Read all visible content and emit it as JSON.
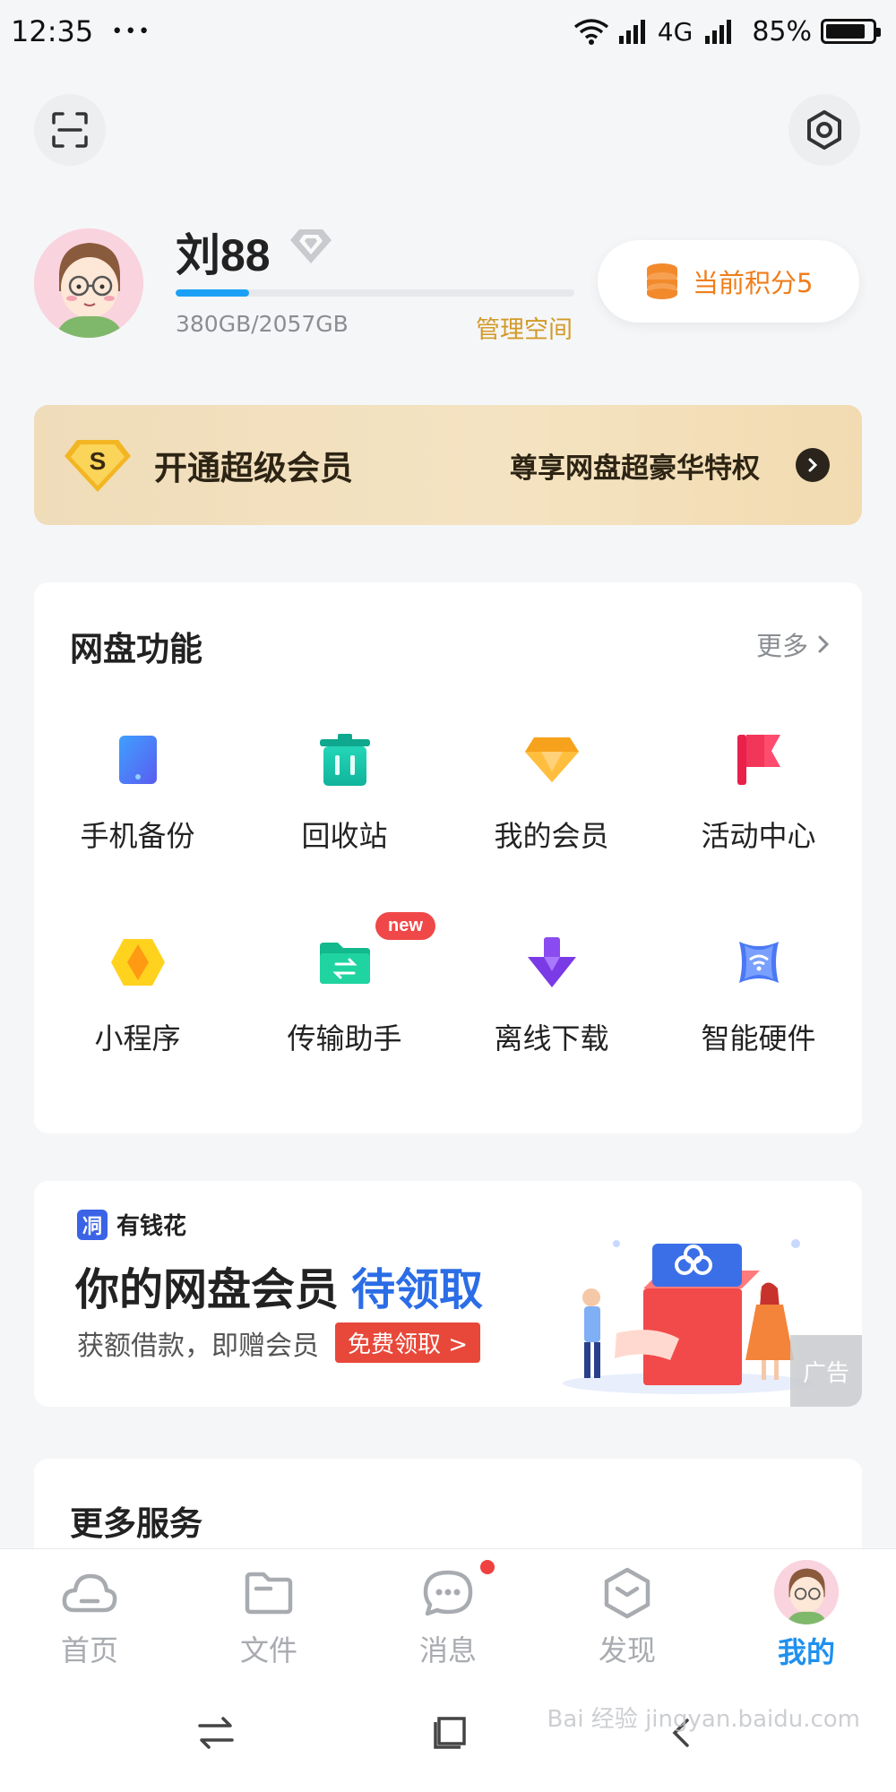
{
  "status_bar": {
    "time": "12:35",
    "dots": "•••",
    "network": "4G",
    "battery": "85%",
    "battery_level": 0.85
  },
  "profile": {
    "username": "刘88",
    "storage_text": "380GB/2057GB",
    "storage_used_fraction": 0.185,
    "manage_label": "管理空间",
    "points_label": "当前积分5"
  },
  "vip_banner": {
    "title": "开通超级会员",
    "subtitle": "尊享网盘超豪华特权"
  },
  "functions": {
    "title": "网盘功能",
    "more_label": "更多",
    "items": [
      {
        "label": "手机备份",
        "icon": "phone-backup-icon"
      },
      {
        "label": "回收站",
        "icon": "recycle-bin-icon"
      },
      {
        "label": "我的会员",
        "icon": "diamond-icon"
      },
      {
        "label": "活动中心",
        "icon": "flag-icon"
      },
      {
        "label": "小程序",
        "icon": "mini-program-icon"
      },
      {
        "label": "传输助手",
        "icon": "transfer-folder-icon",
        "badge": "new"
      },
      {
        "label": "离线下载",
        "icon": "download-arrow-icon"
      },
      {
        "label": "智能硬件",
        "icon": "wifi-device-icon"
      }
    ]
  },
  "ad": {
    "brand_logo_char": "㓊",
    "brand": "有钱花",
    "headline": "你的网盘会员",
    "headline_highlight": "待领取",
    "sub": "获额借款，即赠会员",
    "cta": "免费领取 >",
    "tag": "广告"
  },
  "services": {
    "title": "更多服务"
  },
  "bottom_nav": {
    "items": [
      {
        "label": "首页",
        "icon": "cloud-icon"
      },
      {
        "label": "文件",
        "icon": "folder-icon"
      },
      {
        "label": "消息",
        "icon": "chat-icon"
      },
      {
        "label": "发现",
        "icon": "discover-icon"
      },
      {
        "label": "我的",
        "icon": "avatar"
      }
    ],
    "active_index": 4
  },
  "watermark": "Bai 经验 jingyan.baidu.com",
  "colors": {
    "accent_blue": "#1f90f0",
    "points_orange": "#f07d1a",
    "manage_gold": "#d39a28",
    "badge_red": "#f04848"
  }
}
